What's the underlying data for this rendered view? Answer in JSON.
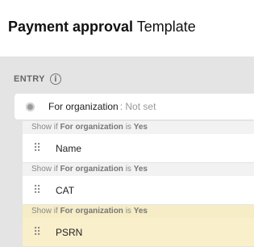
{
  "page": {
    "title_bold": "Payment approval",
    "title_light": "Template"
  },
  "entry": {
    "section_label": "ENTRY",
    "info_icon": "i",
    "field": {
      "label": "For organization",
      "value": ": Not set"
    }
  },
  "rows": [
    {
      "condition_prefix": "Show if",
      "condition_field": "For organization",
      "condition_mid": "is",
      "condition_value": "Yes",
      "label": "Name",
      "highlighted": false
    },
    {
      "condition_prefix": "Show if",
      "condition_field": "For organization",
      "condition_mid": "is",
      "condition_value": "Yes",
      "label": "CAT",
      "highlighted": false
    },
    {
      "condition_prefix": "Show if",
      "condition_field": "For organization",
      "condition_mid": "is",
      "condition_value": "Yes",
      "label": "PSRN",
      "highlighted": true
    }
  ],
  "icons": {
    "drag_handle": "drag-handle-icon",
    "radio": "radio-icon",
    "info": "info-icon"
  },
  "colors": {
    "panel_bg": "#e4e4e4",
    "highlight_bg": "#f6ecc5"
  }
}
